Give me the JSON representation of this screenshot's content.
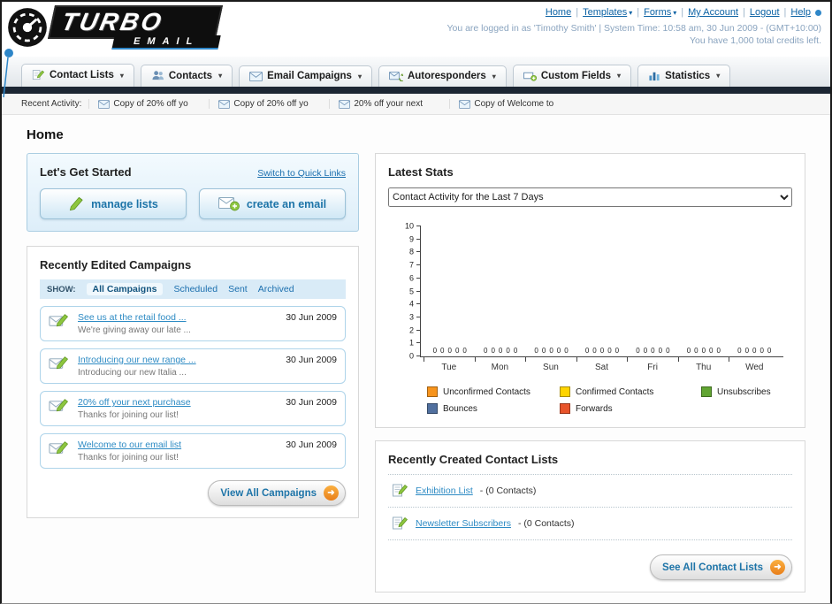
{
  "page_title": "Home",
  "icons": {
    "chevron_down": "▾",
    "arrow_right": "➜"
  },
  "header": {
    "logo": {
      "title": "TURBO",
      "subtitle": "EMAIL"
    },
    "links": [
      {
        "label": "Home"
      },
      {
        "label": "Templates"
      },
      {
        "label": "Forms"
      },
      {
        "label": "My Account"
      },
      {
        "label": "Logout"
      },
      {
        "label": "Help"
      }
    ],
    "session_info": "You are logged in as 'Timothy Smith' | System Time: 10:58 am, 30 Jun 2009 - (GMT+10:00)",
    "credits_info": "You have 1,000 total credits left."
  },
  "nav": {
    "tabs": [
      {
        "label": "Contact Lists"
      },
      {
        "label": "Contacts"
      },
      {
        "label": "Email Campaigns"
      },
      {
        "label": "Autoresponders"
      },
      {
        "label": "Custom Fields"
      },
      {
        "label": "Statistics"
      }
    ]
  },
  "recent_activity": {
    "label": "Recent Activity:",
    "items": [
      "Copy of 20% off yo",
      "Copy of 20% off yo",
      "20% off your next",
      "Copy of Welcome to"
    ]
  },
  "get_started": {
    "title": "Let's Get Started",
    "switch_link": "Switch to Quick Links",
    "manage_lists_button": "manage lists",
    "create_email_button": "create an email"
  },
  "campaigns": {
    "title": "Recently Edited Campaigns",
    "show_label": "SHOW:",
    "filters": [
      "All Campaigns",
      "Scheduled",
      "Sent",
      "Archived"
    ],
    "items": [
      {
        "title": "See us at the retail food ...",
        "subtitle": "We're giving away our late ...",
        "date": "30 Jun 2009"
      },
      {
        "title": "Introducing our new range ...",
        "subtitle": "Introducing our new Italia ...",
        "date": "30 Jun 2009"
      },
      {
        "title": "20% off your next purchase",
        "subtitle": "Thanks for joining our list!",
        "date": "30 Jun 2009"
      },
      {
        "title": "Welcome to our email list",
        "subtitle": "Thanks for joining our list!",
        "date": "30 Jun 2009"
      }
    ],
    "view_all_button": "View All Campaigns"
  },
  "stats": {
    "title": "Latest Stats",
    "dropdown_value": "Contact Activity for the Last 7 Days",
    "chart_data": {
      "type": "bar",
      "title": "Contact Activity for the Last 7 Days",
      "categories": [
        "Tue",
        "Mon",
        "Sun",
        "Sat",
        "Fri",
        "Thu",
        "Wed"
      ],
      "series": [
        {
          "name": "Unconfirmed Contacts",
          "color": "#f7941d",
          "values": [
            0,
            0,
            0,
            0,
            0,
            0,
            0
          ]
        },
        {
          "name": "Confirmed Contacts",
          "color": "#ffd400",
          "values": [
            0,
            0,
            0,
            0,
            0,
            0,
            0
          ]
        },
        {
          "name": "Unsubscribes",
          "color": "#61a532",
          "values": [
            0,
            0,
            0,
            0,
            0,
            0,
            0
          ]
        },
        {
          "name": "Bounces",
          "color": "#51709f",
          "values": [
            0,
            0,
            0,
            0,
            0,
            0,
            0
          ]
        },
        {
          "name": "Forwards",
          "color": "#e8542b",
          "values": [
            0,
            0,
            0,
            0,
            0,
            0,
            0
          ]
        }
      ],
      "ylim": [
        0,
        10
      ],
      "grid": false,
      "legend_position": "bottom"
    }
  },
  "contact_lists": {
    "title": "Recently Created Contact Lists",
    "items": [
      {
        "name": "Exhibition List",
        "suffix": "- (0 Contacts)"
      },
      {
        "name": "Newsletter Subscribers",
        "suffix": "- (0 Contacts)"
      }
    ],
    "see_all_button": "See All Contact Lists"
  }
}
